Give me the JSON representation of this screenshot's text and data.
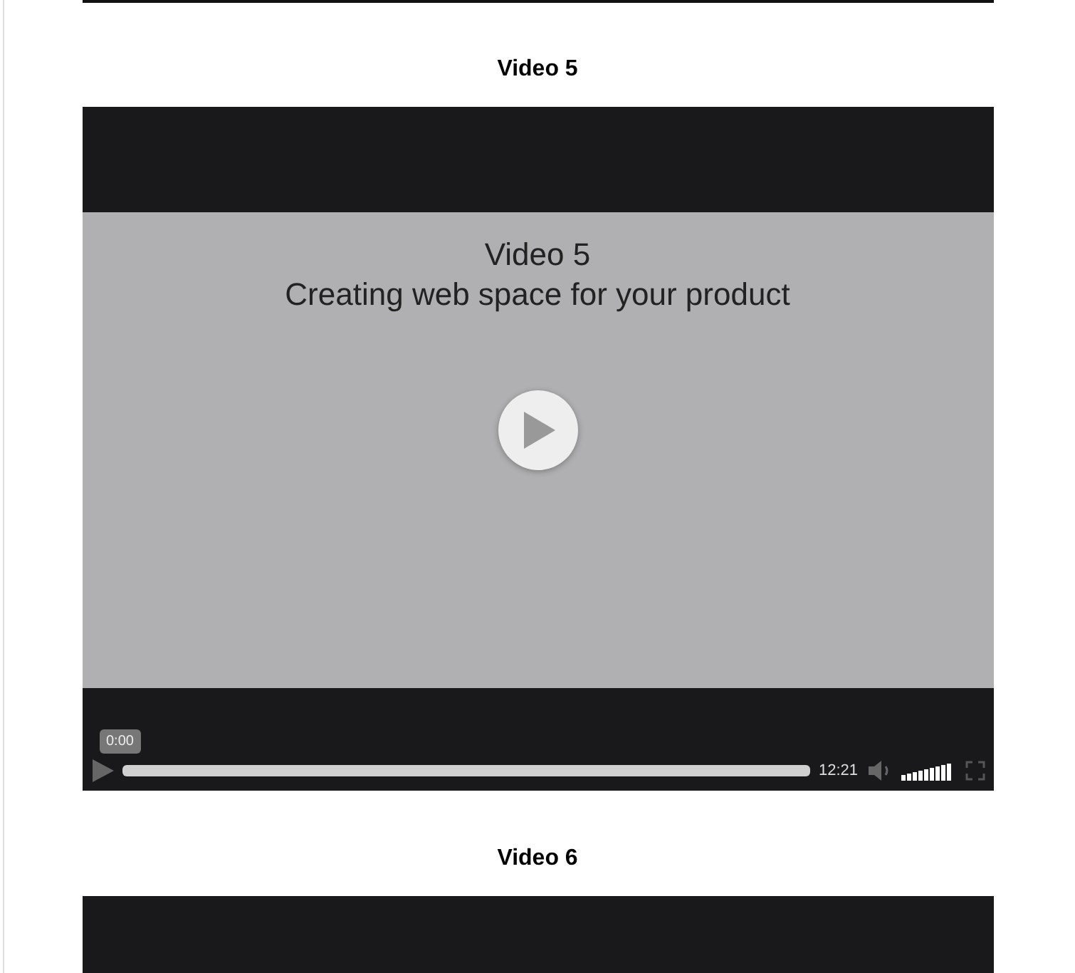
{
  "videos": [
    {
      "heading": "Video 5",
      "poster": {
        "title": "Video 5",
        "subtitle": "Creating web space for your product"
      },
      "controls": {
        "current_time": "0:00",
        "duration": "12:21",
        "progress": {
          "level": 0
        },
        "volume": {
          "level": 1
        }
      }
    },
    {
      "heading": "Video 6"
    }
  ]
}
